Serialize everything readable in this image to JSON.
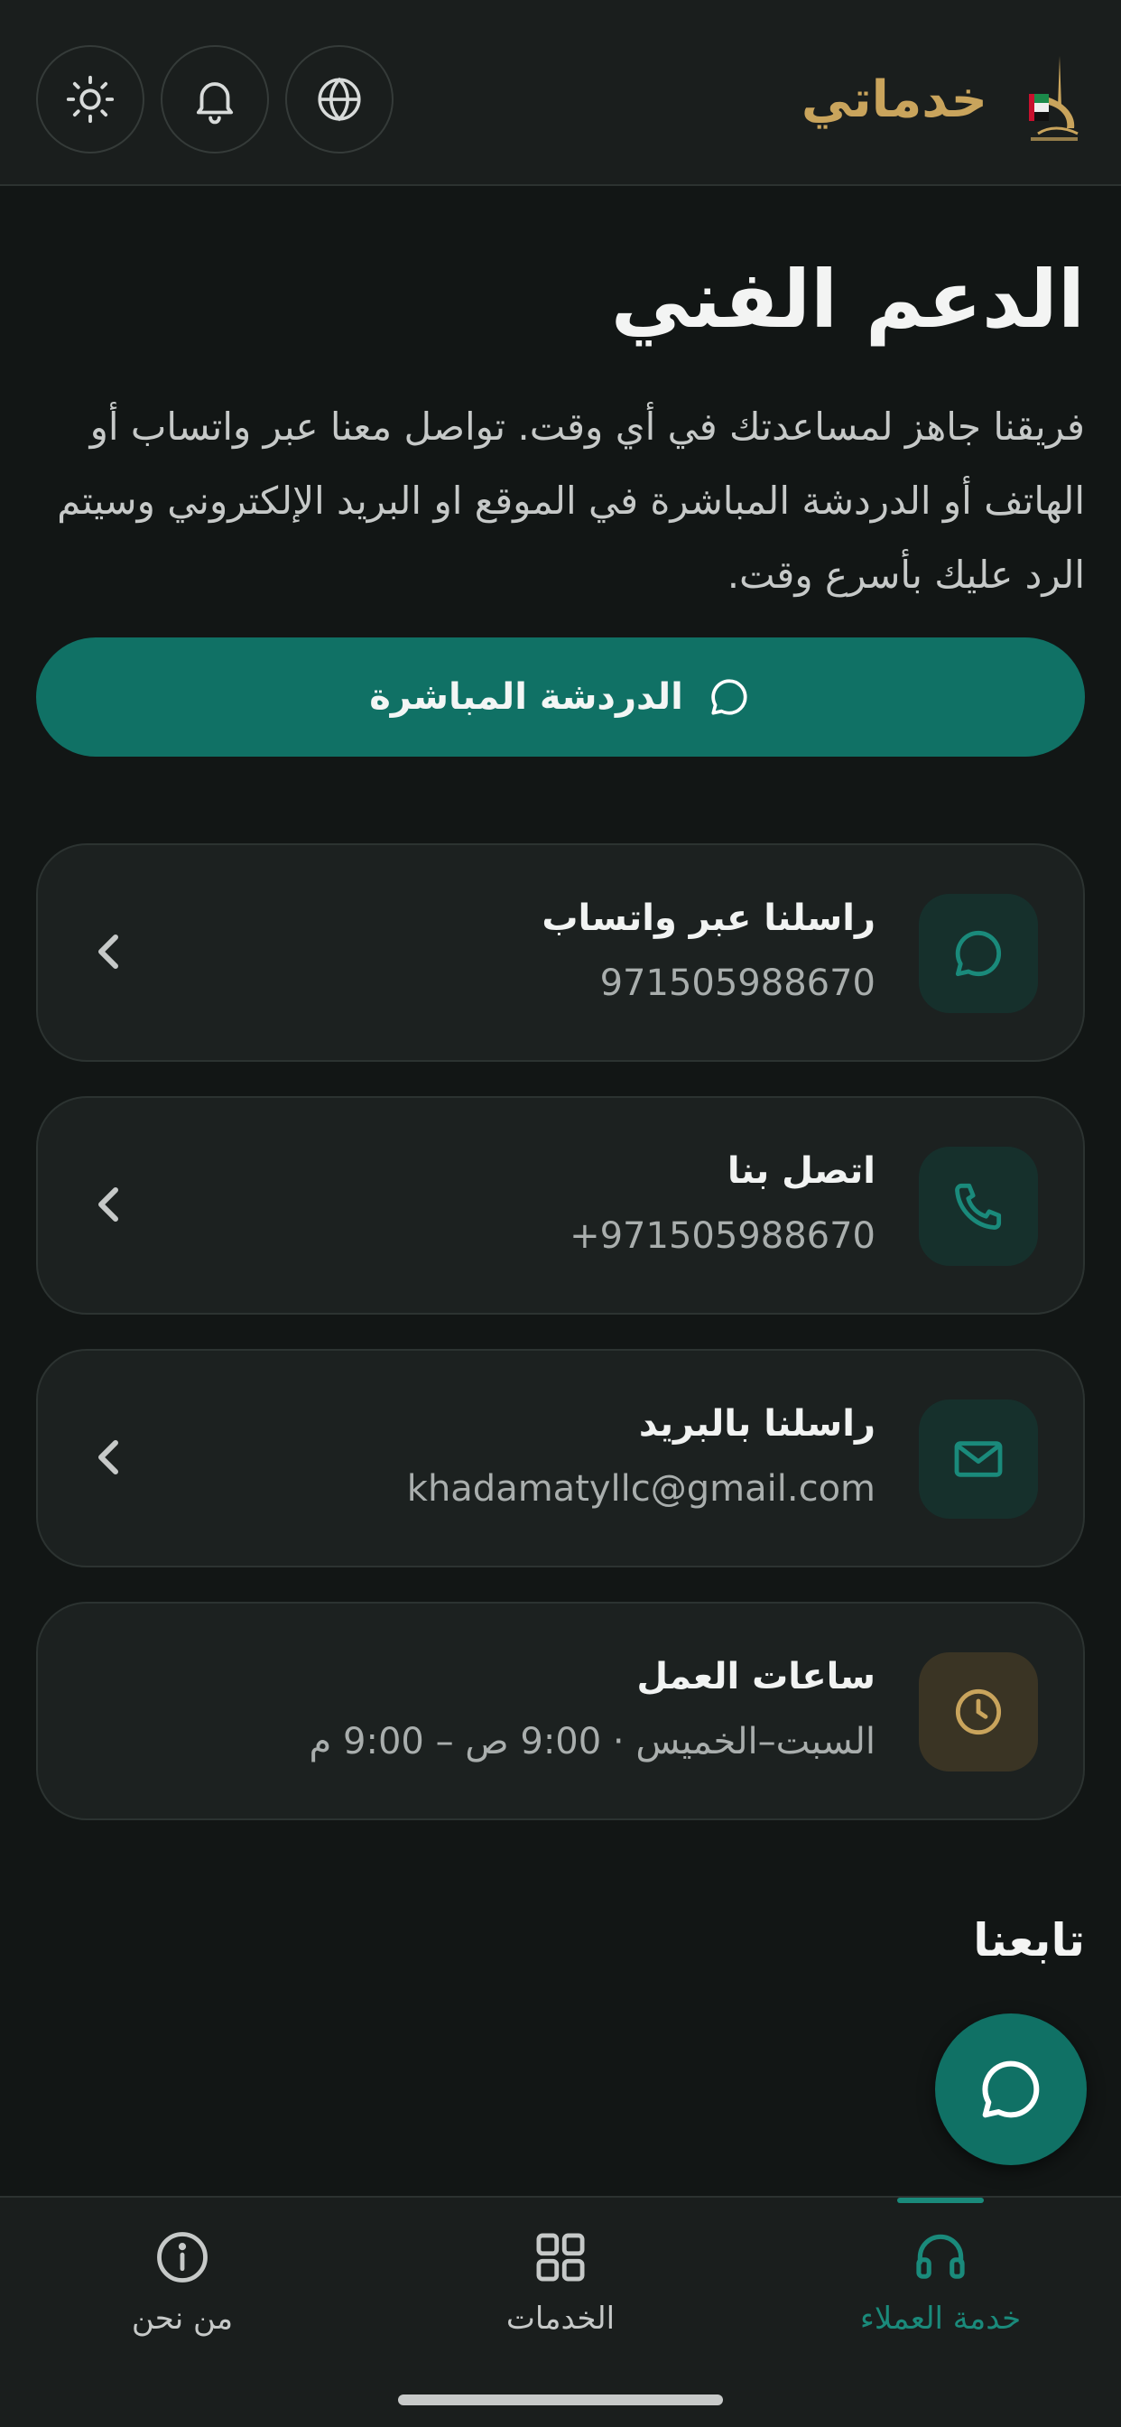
{
  "header": {
    "app_name": "خدماتي",
    "logo_icon": "khadamaty-logo",
    "buttons": [
      "language-globe-icon",
      "notifications-bell-icon",
      "theme-sun-icon"
    ]
  },
  "page": {
    "title": "الدعم الفني",
    "description": "فريقنا جاهز لمساعدتك في أي وقت. تواصل معنا عبر واتساب أو الهاتف أو الدردشة المباشرة في الموقع او البريد الإلكتروني وسيتم الرد عليك بأسرع وقت."
  },
  "live_chat_button": {
    "label": "الدردشة المباشرة",
    "icon": "chat-bubble-icon"
  },
  "contacts": [
    {
      "title": "راسلنا عبر واتساب",
      "value": "971505988670",
      "icon": "whatsapp-chat-icon"
    },
    {
      "title": "اتصل بنا",
      "value": "+971505988670",
      "icon": "phone-icon"
    },
    {
      "title": "راسلنا بالبريد",
      "value": "khadamatyllc@gmail.com",
      "icon": "mail-icon"
    },
    {
      "title": "ساعات العمل",
      "value": "السبت–الخميس · 9:00 ص – 9:00 م",
      "icon": "clock-icon"
    }
  ],
  "follow_us": "تابعنا",
  "bottom_nav": {
    "items": [
      {
        "label": "خدمة العملاء",
        "icon": "headset-icon",
        "active": true
      },
      {
        "label": "الخدمات",
        "icon": "grid-icon",
        "active": false
      },
      {
        "label": "من نحن",
        "icon": "info-icon",
        "active": false
      }
    ]
  },
  "colors": {
    "accent": "#107165",
    "gold": "#c9a45c",
    "background": "#121615",
    "card": "#1c2120"
  }
}
